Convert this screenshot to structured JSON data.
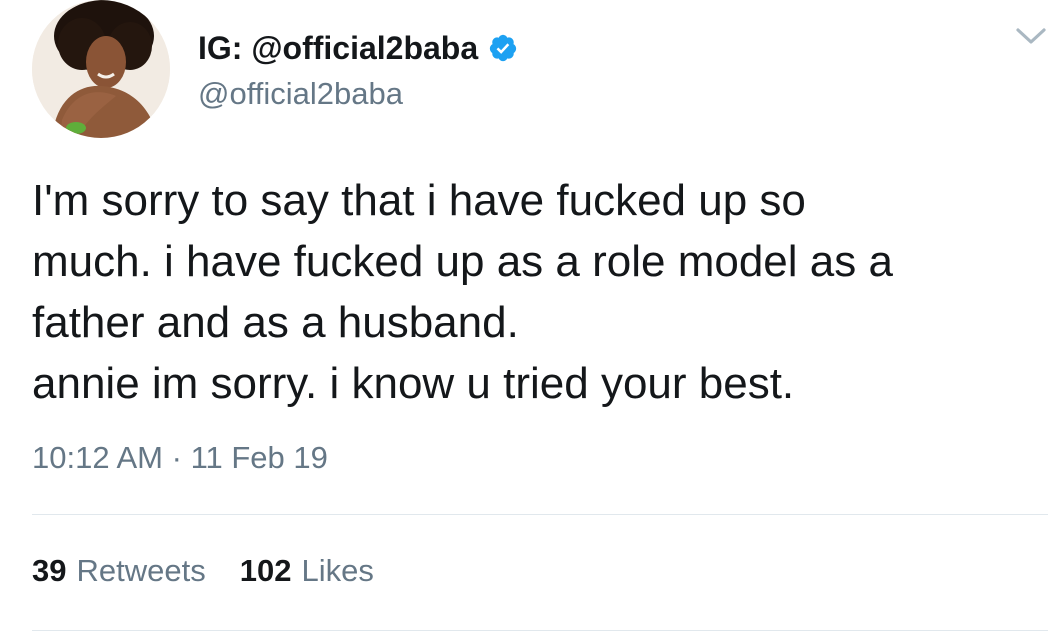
{
  "author": {
    "display_name": "IG: @official2baba",
    "handle": "@official2baba",
    "verified": true,
    "avatar": "profile-photo"
  },
  "tweet": {
    "lines": [
      "I'm sorry to say that i have fucked up so",
      "much. i have fucked up as a role model as a",
      "father and as a husband.",
      "annie im sorry. i know u tried your best."
    ],
    "time": "10:12 AM",
    "separator": "·",
    "date": "11 Feb 19"
  },
  "stats": {
    "retweets_count": "39",
    "retweets_label": "Retweets",
    "likes_count": "102",
    "likes_label": "Likes"
  },
  "icons": {
    "verified": "verified-badge-icon",
    "menu": "chevron-down-icon"
  },
  "colors": {
    "text": "#14171a",
    "secondary": "#657786",
    "verified": "#1da1f2",
    "divider": "#e1e8ed"
  }
}
